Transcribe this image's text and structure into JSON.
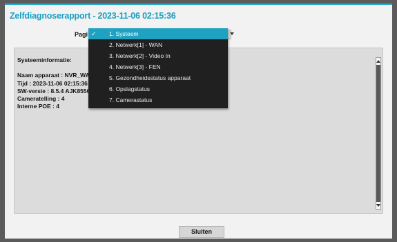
{
  "dialog": {
    "title": "Zelfdiagnoserapport - 2023-11-06 02:15:36",
    "page_label": "Pagi",
    "close_label": "Sluiten"
  },
  "info": {
    "heading": "Systeeminformatie:",
    "lines": [
      "Naam apparaat : NVR_WAN",
      "Tijd : 2023-11-06 02:15:36",
      "SW-versie : 8.5.4 AJK8556 (",
      "Cameratelling : 4",
      "Interne POE : 4"
    ]
  },
  "dropdown": {
    "selected_index": 0,
    "items": [
      "1. Systeem",
      "2. Netwerk[1] - WAN",
      "3. Netwerk[2] - Video In",
      "4. Netwerk[3] - FEN",
      "5. Gezondheidsstatus apparaat",
      "6. Opslagstatus",
      "7. Camerastatus"
    ],
    "check_glyph": "✓"
  },
  "colors": {
    "accent": "#1fa2c2",
    "title": "#17a0c4",
    "dropdown_bg": "#202020"
  }
}
